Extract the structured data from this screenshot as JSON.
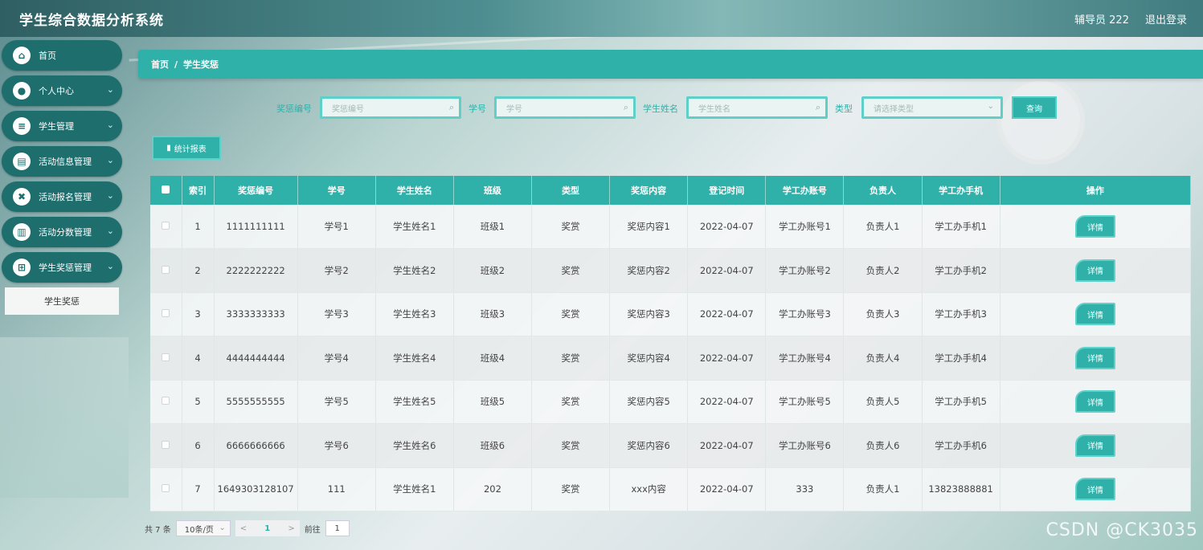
{
  "app": {
    "title": "学生综合数据分析系统"
  },
  "header": {
    "user": "辅导员 222",
    "logout": "退出登录"
  },
  "sidebar": {
    "items": [
      {
        "label": "首页",
        "icon": "home-icon",
        "glyph": "⌂"
      },
      {
        "label": "个人中心",
        "icon": "user-icon",
        "glyph": "●"
      },
      {
        "label": "学生管理",
        "icon": "list-icon",
        "glyph": "≡"
      },
      {
        "label": "活动信息管理",
        "icon": "calendar-icon",
        "glyph": "▤"
      },
      {
        "label": "活动报名管理",
        "icon": "sign-icon",
        "glyph": "✖"
      },
      {
        "label": "活动分数管理",
        "icon": "chart-icon",
        "glyph": "▥"
      },
      {
        "label": "学生奖惩管理",
        "icon": "grid-icon",
        "glyph": "⊞"
      }
    ],
    "submenu": "学生奖惩",
    "arrow": "⌄"
  },
  "breadcrumb": {
    "home": "首页",
    "sep": "/",
    "current": "学生奖惩"
  },
  "search": {
    "code_label": "奖惩编号",
    "code_placeholder": "奖惩编号",
    "id_label": "学号",
    "id_placeholder": "学号",
    "name_label": "学生姓名",
    "name_placeholder": "学生姓名",
    "type_label": "类型",
    "type_placeholder": "请选择类型",
    "query": "查询"
  },
  "toolbar": {
    "stats_label": "统计报表"
  },
  "table": {
    "headers": [
      "索引",
      "奖惩编号",
      "学号",
      "学生姓名",
      "班级",
      "类型",
      "奖惩内容",
      "登记时间",
      "学工办账号",
      "负责人",
      "学工办手机",
      "操作"
    ],
    "detail_label": "详情",
    "rows": [
      [
        "1",
        "1111111111",
        "学号1",
        "学生姓名1",
        "班级1",
        "奖赏",
        "奖惩内容1",
        "2022-04-07",
        "学工办账号1",
        "负责人1",
        "学工办手机1"
      ],
      [
        "2",
        "2222222222",
        "学号2",
        "学生姓名2",
        "班级2",
        "奖赏",
        "奖惩内容2",
        "2022-04-07",
        "学工办账号2",
        "负责人2",
        "学工办手机2"
      ],
      [
        "3",
        "3333333333",
        "学号3",
        "学生姓名3",
        "班级3",
        "奖赏",
        "奖惩内容3",
        "2022-04-07",
        "学工办账号3",
        "负责人3",
        "学工办手机3"
      ],
      [
        "4",
        "4444444444",
        "学号4",
        "学生姓名4",
        "班级4",
        "奖赏",
        "奖惩内容4",
        "2022-04-07",
        "学工办账号4",
        "负责人4",
        "学工办手机4"
      ],
      [
        "5",
        "5555555555",
        "学号5",
        "学生姓名5",
        "班级5",
        "奖赏",
        "奖惩内容5",
        "2022-04-07",
        "学工办账号5",
        "负责人5",
        "学工办手机5"
      ],
      [
        "6",
        "6666666666",
        "学号6",
        "学生姓名6",
        "班级6",
        "奖赏",
        "奖惩内容6",
        "2022-04-07",
        "学工办账号6",
        "负责人6",
        "学工办手机6"
      ],
      [
        "7",
        "1649303128107",
        "111",
        "学生姓名1",
        "202",
        "奖赏",
        "xxx内容",
        "2022-04-07",
        "333",
        "负责人1",
        "13823888881"
      ]
    ]
  },
  "pagination": {
    "total": "共 7 条",
    "page_size": "10条/页",
    "prev": "<",
    "current": "1",
    "next": ">",
    "goto": "前往",
    "goto_value": "1"
  },
  "watermark": "CSDN @CK3035",
  "colors": {
    "accent": "#2fb1aa",
    "sidebar": "#1e6e6d"
  }
}
